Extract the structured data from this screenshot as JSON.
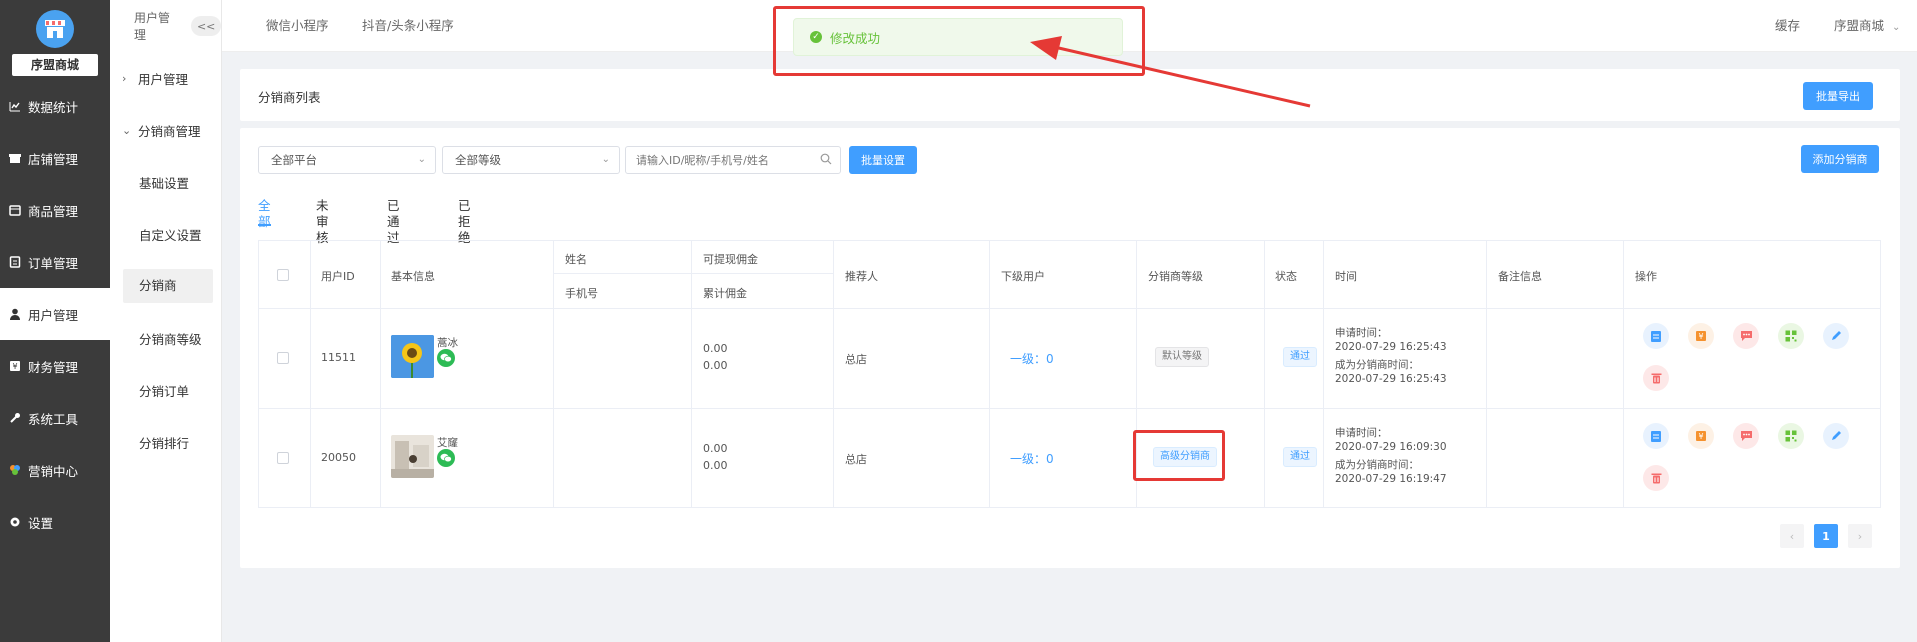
{
  "app": {
    "shop_name": "序盟商城"
  },
  "sidebar": {
    "items": [
      {
        "label": "数据统计",
        "icon": "chart-icon"
      },
      {
        "label": "店铺管理",
        "icon": "home-icon"
      },
      {
        "label": "商品管理",
        "icon": "product-icon"
      },
      {
        "label": "订单管理",
        "icon": "order-icon"
      },
      {
        "label": "用户管理",
        "icon": "user-icon",
        "active": true
      },
      {
        "label": "财务管理",
        "icon": "finance-icon"
      },
      {
        "label": "系统工具",
        "icon": "wrench-icon"
      },
      {
        "label": "营销中心",
        "icon": "marketing-icon"
      },
      {
        "label": "设置",
        "icon": "settings-icon"
      }
    ]
  },
  "submenu": {
    "header": "用户管理",
    "collapse": "<<",
    "groups": [
      {
        "label": "用户管理"
      },
      {
        "label": "分销商管理"
      }
    ],
    "items": [
      "基础设置",
      "自定义设置",
      "分销商",
      "分销商等级",
      "分销订单",
      "分销排行"
    ],
    "active_item": "分销商"
  },
  "topbar": {
    "tabs": [
      "微信小程序",
      "抖音/头条小程序"
    ],
    "cache": "缓存",
    "account": "序盟商城"
  },
  "toast": {
    "message": "修改成功"
  },
  "list_header": {
    "title": "分销商列表",
    "export_button": "批量导出"
  },
  "filters": {
    "platform": "全部平台",
    "level": "全部等级",
    "search_placeholder": "请输入ID/昵称/手机号/姓名",
    "batch_button": "批量设置",
    "add_button": "添加分销商"
  },
  "tabs": [
    "全部",
    "未审核",
    "已通过",
    "已拒绝"
  ],
  "table": {
    "headers": {
      "user_id": "用户ID",
      "basic_info": "基本信息",
      "name": "姓名",
      "phone": "手机号",
      "withdrawable": "可提现佣金",
      "total": "累计佣金",
      "referrer": "推荐人",
      "subordinates": "下级用户",
      "level": "分销商等级",
      "status": "状态",
      "time": "时间",
      "remark": "备注信息",
      "actions": "操作"
    },
    "rows": [
      {
        "user_id": "11511",
        "nickname": "蒿冰",
        "withdrawable": "0.00",
        "total": "0.00",
        "referrer": "总店",
        "subordinates": "一级：0",
        "level": "默认等级",
        "status": "通过",
        "apply_label": "申请时间：",
        "apply_time": "2020-07-29 16:25:43",
        "become_label": "成为分销商时间：",
        "become_time": "2020-07-29 16:25:43"
      },
      {
        "user_id": "20050",
        "nickname": "艾窿",
        "withdrawable": "0.00",
        "total": "0.00",
        "referrer": "总店",
        "subordinates": "一级：0",
        "level": "高级分销商",
        "status": "通过",
        "apply_label": "申请时间：",
        "apply_time": "2020-07-29 16:09:30",
        "become_label": "成为分销商时间：",
        "become_time": "2020-07-29 16:19:47"
      }
    ]
  },
  "pagination": {
    "prev": "‹",
    "current": "1",
    "next": "›"
  },
  "colors": {
    "primary": "#409eff",
    "success": "#67c23a",
    "annotation": "#e53935",
    "sidebar": "#3b3b3b"
  }
}
